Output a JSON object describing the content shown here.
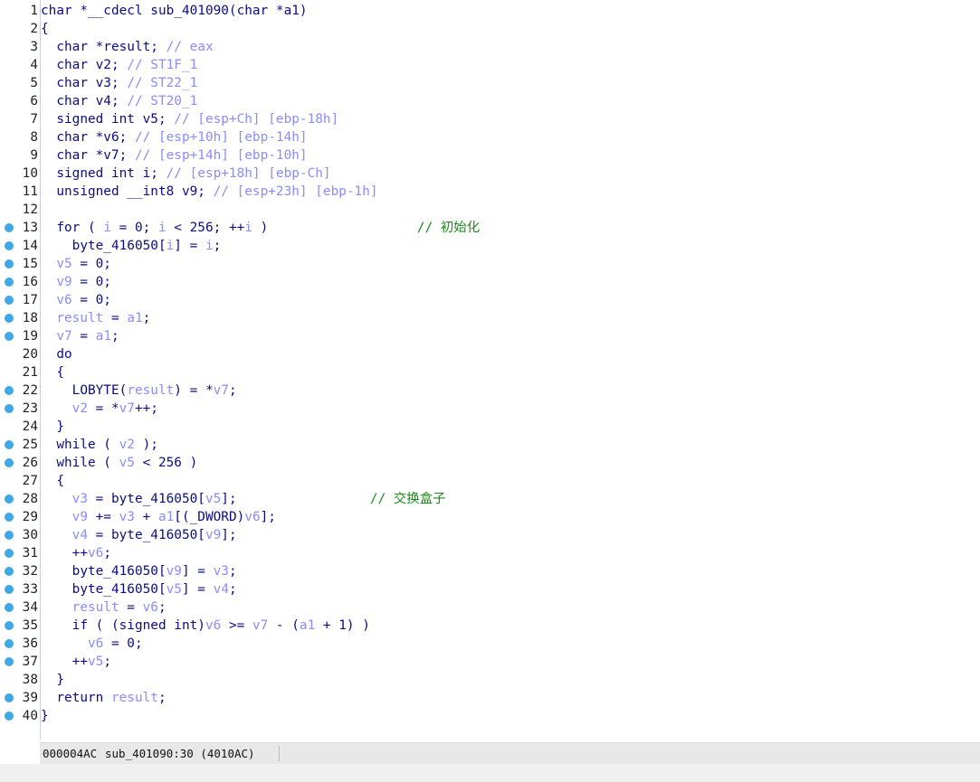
{
  "lines": [
    {
      "n": "1",
      "bp": false,
      "segs": [
        {
          "t": "char *__cdecl sub_401090(char *a1)",
          "c": "kw"
        }
      ]
    },
    {
      "n": "2",
      "bp": false,
      "segs": [
        {
          "t": "{",
          "c": "kw"
        }
      ]
    },
    {
      "n": "3",
      "bp": false,
      "segs": [
        {
          "t": "  char *result; ",
          "c": "kw"
        },
        {
          "t": "// eax",
          "c": "cmt"
        }
      ]
    },
    {
      "n": "4",
      "bp": false,
      "segs": [
        {
          "t": "  char v2; ",
          "c": "kw"
        },
        {
          "t": "// ST1F_1",
          "c": "cmt"
        }
      ]
    },
    {
      "n": "5",
      "bp": false,
      "segs": [
        {
          "t": "  char v3; ",
          "c": "kw"
        },
        {
          "t": "// ST22_1",
          "c": "cmt"
        }
      ]
    },
    {
      "n": "6",
      "bp": false,
      "segs": [
        {
          "t": "  char v4; ",
          "c": "kw"
        },
        {
          "t": "// ST20_1",
          "c": "cmt"
        }
      ]
    },
    {
      "n": "7",
      "bp": false,
      "segs": [
        {
          "t": "  signed int v5; ",
          "c": "kw"
        },
        {
          "t": "// [esp+Ch] [ebp-18h]",
          "c": "cmt"
        }
      ]
    },
    {
      "n": "8",
      "bp": false,
      "segs": [
        {
          "t": "  char *v6; ",
          "c": "kw"
        },
        {
          "t": "// [esp+10h] [ebp-14h]",
          "c": "cmt"
        }
      ]
    },
    {
      "n": "9",
      "bp": false,
      "segs": [
        {
          "t": "  char *v7; ",
          "c": "kw"
        },
        {
          "t": "// [esp+14h] [ebp-10h]",
          "c": "cmt"
        }
      ]
    },
    {
      "n": "10",
      "bp": false,
      "segs": [
        {
          "t": "  signed int i; ",
          "c": "kw"
        },
        {
          "t": "// [esp+18h] [ebp-Ch]",
          "c": "cmt"
        }
      ]
    },
    {
      "n": "11",
      "bp": false,
      "segs": [
        {
          "t": "  unsigned __int8 v9; ",
          "c": "kw"
        },
        {
          "t": "// [esp+23h] [ebp-1h]",
          "c": "cmt"
        }
      ]
    },
    {
      "n": "12",
      "bp": false,
      "segs": [
        {
          "t": "",
          "c": "kw"
        }
      ]
    },
    {
      "n": "13",
      "bp": true,
      "segs": [
        {
          "t": "  for ( ",
          "c": "kw"
        },
        {
          "t": "i",
          "c": "var"
        },
        {
          "t": " = 0; ",
          "c": "kw"
        },
        {
          "t": "i",
          "c": "var"
        },
        {
          "t": " < 256; ++",
          "c": "kw"
        },
        {
          "t": "i",
          "c": "var"
        },
        {
          "t": " )                   ",
          "c": "kw"
        },
        {
          "t": "// ",
          "c": "cmtg"
        },
        {
          "t": "初始化",
          "c": "cn"
        }
      ]
    },
    {
      "n": "14",
      "bp": true,
      "segs": [
        {
          "t": "    byte_416050[",
          "c": "kw"
        },
        {
          "t": "i",
          "c": "var"
        },
        {
          "t": "] = ",
          "c": "kw"
        },
        {
          "t": "i",
          "c": "var"
        },
        {
          "t": ";",
          "c": "kw"
        }
      ]
    },
    {
      "n": "15",
      "bp": true,
      "segs": [
        {
          "t": "  ",
          "c": "kw"
        },
        {
          "t": "v5",
          "c": "var"
        },
        {
          "t": " = 0;",
          "c": "kw"
        }
      ]
    },
    {
      "n": "16",
      "bp": true,
      "segs": [
        {
          "t": "  ",
          "c": "kw"
        },
        {
          "t": "v9",
          "c": "var"
        },
        {
          "t": " = 0;",
          "c": "kw"
        }
      ]
    },
    {
      "n": "17",
      "bp": true,
      "segs": [
        {
          "t": "  ",
          "c": "kw"
        },
        {
          "t": "v6",
          "c": "var"
        },
        {
          "t": " = 0;",
          "c": "kw"
        }
      ]
    },
    {
      "n": "18",
      "bp": true,
      "segs": [
        {
          "t": "  ",
          "c": "kw"
        },
        {
          "t": "result",
          "c": "var"
        },
        {
          "t": " = ",
          "c": "kw"
        },
        {
          "t": "a1",
          "c": "var"
        },
        {
          "t": ";",
          "c": "kw"
        }
      ]
    },
    {
      "n": "19",
      "bp": true,
      "segs": [
        {
          "t": "  ",
          "c": "kw"
        },
        {
          "t": "v7",
          "c": "var"
        },
        {
          "t": " = ",
          "c": "kw"
        },
        {
          "t": "a1",
          "c": "var"
        },
        {
          "t": ";",
          "c": "kw"
        }
      ]
    },
    {
      "n": "20",
      "bp": false,
      "segs": [
        {
          "t": "  do",
          "c": "kw"
        }
      ]
    },
    {
      "n": "21",
      "bp": false,
      "segs": [
        {
          "t": "  {",
          "c": "kw"
        }
      ]
    },
    {
      "n": "22",
      "bp": true,
      "segs": [
        {
          "t": "    LOBYTE(",
          "c": "kw"
        },
        {
          "t": "result",
          "c": "var"
        },
        {
          "t": ") = *",
          "c": "kw"
        },
        {
          "t": "v7",
          "c": "var"
        },
        {
          "t": ";",
          "c": "kw"
        }
      ]
    },
    {
      "n": "23",
      "bp": true,
      "segs": [
        {
          "t": "    ",
          "c": "kw"
        },
        {
          "t": "v2",
          "c": "var"
        },
        {
          "t": " = *",
          "c": "kw"
        },
        {
          "t": "v7",
          "c": "var"
        },
        {
          "t": "++;",
          "c": "kw"
        }
      ]
    },
    {
      "n": "24",
      "bp": false,
      "segs": [
        {
          "t": "  }",
          "c": "kw"
        }
      ]
    },
    {
      "n": "25",
      "bp": true,
      "segs": [
        {
          "t": "  while ( ",
          "c": "kw"
        },
        {
          "t": "v2",
          "c": "var"
        },
        {
          "t": " );",
          "c": "kw"
        }
      ]
    },
    {
      "n": "26",
      "bp": true,
      "segs": [
        {
          "t": "  while ( ",
          "c": "kw"
        },
        {
          "t": "v5",
          "c": "var"
        },
        {
          "t": " < 256 )",
          "c": "kw"
        }
      ]
    },
    {
      "n": "27",
      "bp": false,
      "segs": [
        {
          "t": "  {",
          "c": "kw"
        }
      ]
    },
    {
      "n": "28",
      "bp": true,
      "segs": [
        {
          "t": "    ",
          "c": "kw"
        },
        {
          "t": "v3",
          "c": "var"
        },
        {
          "t": " = byte_416050[",
          "c": "kw"
        },
        {
          "t": "v5",
          "c": "var"
        },
        {
          "t": "];                 ",
          "c": "kw"
        },
        {
          "t": "// ",
          "c": "cmtg"
        },
        {
          "t": "交换盒子",
          "c": "cn"
        }
      ]
    },
    {
      "n": "29",
      "bp": true,
      "segs": [
        {
          "t": "    ",
          "c": "kw"
        },
        {
          "t": "v9",
          "c": "var"
        },
        {
          "t": " += ",
          "c": "kw"
        },
        {
          "t": "v3",
          "c": "var"
        },
        {
          "t": " + ",
          "c": "kw"
        },
        {
          "t": "a1",
          "c": "var"
        },
        {
          "t": "[(_DWORD)",
          "c": "kw"
        },
        {
          "t": "v6",
          "c": "var"
        },
        {
          "t": "];",
          "c": "kw"
        }
      ]
    },
    {
      "n": "30",
      "bp": true,
      "segs": [
        {
          "t": "    ",
          "c": "kw"
        },
        {
          "t": "v4",
          "c": "var"
        },
        {
          "t": " = byte_416050[",
          "c": "kw"
        },
        {
          "t": "v9",
          "c": "var"
        },
        {
          "t": "];",
          "c": "kw"
        }
      ]
    },
    {
      "n": "31",
      "bp": true,
      "segs": [
        {
          "t": "    ++",
          "c": "kw"
        },
        {
          "t": "v6",
          "c": "var"
        },
        {
          "t": ";",
          "c": "kw"
        }
      ]
    },
    {
      "n": "32",
      "bp": true,
      "segs": [
        {
          "t": "    byte_416050[",
          "c": "kw"
        },
        {
          "t": "v9",
          "c": "var"
        },
        {
          "t": "] = ",
          "c": "kw"
        },
        {
          "t": "v3",
          "c": "var"
        },
        {
          "t": ";",
          "c": "kw"
        }
      ]
    },
    {
      "n": "33",
      "bp": true,
      "segs": [
        {
          "t": "    byte_416050[",
          "c": "kw"
        },
        {
          "t": "v5",
          "c": "var"
        },
        {
          "t": "] = ",
          "c": "kw"
        },
        {
          "t": "v4",
          "c": "var"
        },
        {
          "t": ";",
          "c": "kw"
        }
      ]
    },
    {
      "n": "34",
      "bp": true,
      "segs": [
        {
          "t": "    ",
          "c": "kw"
        },
        {
          "t": "result",
          "c": "var"
        },
        {
          "t": " = ",
          "c": "kw"
        },
        {
          "t": "v6",
          "c": "var"
        },
        {
          "t": ";",
          "c": "kw"
        }
      ]
    },
    {
      "n": "35",
      "bp": true,
      "segs": [
        {
          "t": "    if ( (signed int)",
          "c": "kw"
        },
        {
          "t": "v6",
          "c": "var"
        },
        {
          "t": " >= ",
          "c": "kw"
        },
        {
          "t": "v7",
          "c": "var"
        },
        {
          "t": " - (",
          "c": "kw"
        },
        {
          "t": "a1",
          "c": "var"
        },
        {
          "t": " + 1) )",
          "c": "kw"
        }
      ]
    },
    {
      "n": "36",
      "bp": true,
      "segs": [
        {
          "t": "      ",
          "c": "kw"
        },
        {
          "t": "v6",
          "c": "var"
        },
        {
          "t": " = 0;",
          "c": "kw"
        }
      ]
    },
    {
      "n": "37",
      "bp": true,
      "segs": [
        {
          "t": "    ++",
          "c": "kw"
        },
        {
          "t": "v5",
          "c": "var"
        },
        {
          "t": ";",
          "c": "kw"
        }
      ]
    },
    {
      "n": "38",
      "bp": false,
      "segs": [
        {
          "t": "  }",
          "c": "kw"
        }
      ]
    },
    {
      "n": "39",
      "bp": true,
      "segs": [
        {
          "t": "  return ",
          "c": "kw"
        },
        {
          "t": "result",
          "c": "var"
        },
        {
          "t": ";",
          "c": "kw"
        }
      ]
    },
    {
      "n": "40",
      "bp": true,
      "segs": [
        {
          "t": "}",
          "c": "kw"
        }
      ]
    }
  ],
  "status": {
    "offset": "000004AC",
    "location": "sub_401090:30 (4010AC)"
  },
  "colors": {
    "keyword": "#0c0c84",
    "variable": "#8a8cff",
    "comment": "#8a8cff",
    "comment_chinese": "#1a8a1a",
    "breakpoint": "#3fa9e6"
  },
  "icons": {
    "breakpoint": "breakpoint-dot-icon"
  }
}
